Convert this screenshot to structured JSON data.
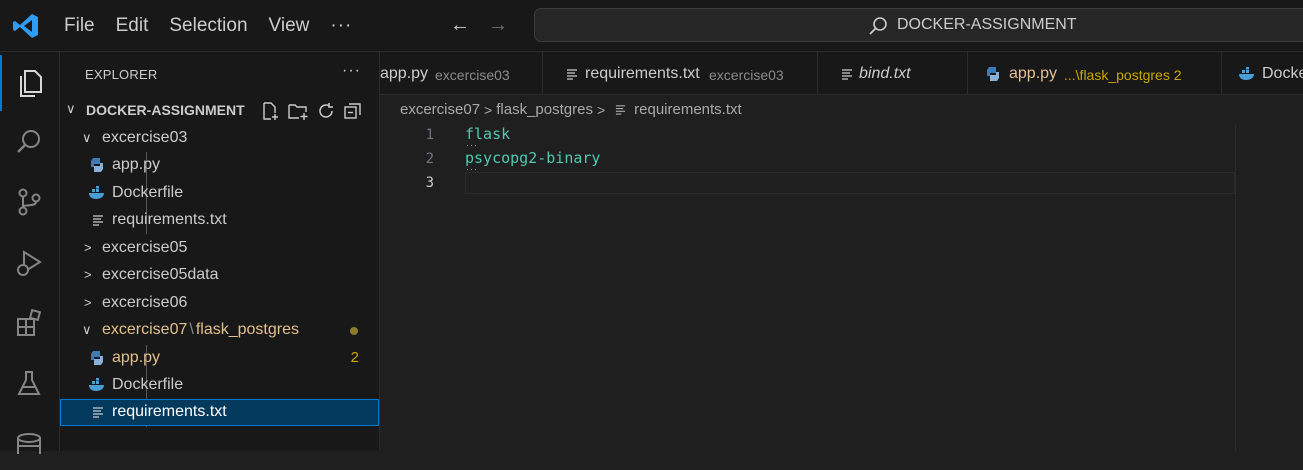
{
  "menu": {
    "file": "File",
    "edit": "Edit",
    "selection": "Selection",
    "view": "View",
    "more": "···"
  },
  "search": {
    "text": "DOCKER-ASSIGNMENT"
  },
  "explorer": {
    "title": "EXPLORER",
    "more": "···",
    "root": "DOCKER-ASSIGNMENT",
    "tree": {
      "ex03": "excercise03",
      "ex03_app": "app.py",
      "ex03_docker": "Dockerfile",
      "ex03_req": "requirements.txt",
      "ex05": "excercise05",
      "ex05data": "excercise05data",
      "ex06": "excercise06",
      "ex07": "excercise07",
      "ex07_sep": "\\",
      "ex07_sub": "flask_postgres",
      "ex07_app": "app.py",
      "ex07_app_problems": "2",
      "ex07_docker": "Dockerfile",
      "ex07_req": "requirements.txt"
    }
  },
  "tabs": [
    {
      "name": "app.py",
      "desc": "excercise03"
    },
    {
      "name": "requirements.txt",
      "desc": "excercise03"
    },
    {
      "name": "bind.txt",
      "desc": ""
    },
    {
      "name": "app.py",
      "desc": "...\\flask_postgres 2"
    },
    {
      "name": "Docke",
      "desc": ""
    }
  ],
  "breadcrumb": {
    "p1": "excercise07",
    "p2": "flask_postgres",
    "p3": "requirements.txt"
  },
  "editor": {
    "lines": [
      {
        "num": "1",
        "text": "flask"
      },
      {
        "num": "2",
        "text": "psycopg2-binary"
      },
      {
        "num": "3",
        "text": ""
      }
    ]
  },
  "colors": {
    "accent": "#0078d4",
    "modified": "#e2c08d",
    "warning": "#cca700",
    "code": "#4ec9b0"
  }
}
